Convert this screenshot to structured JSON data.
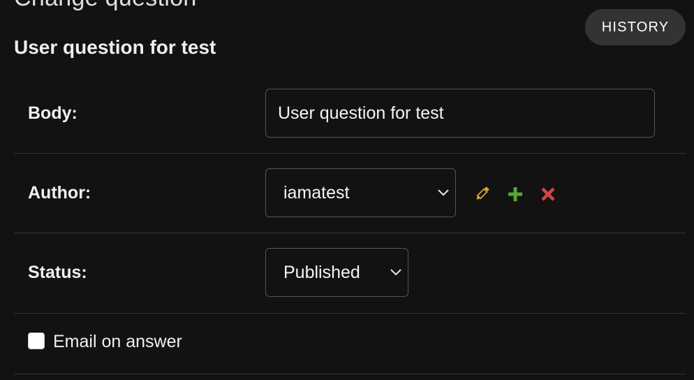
{
  "header": {
    "page_title": "Change question",
    "history_label": "HISTORY"
  },
  "fieldset": {
    "title": "User question for test"
  },
  "fields": {
    "body": {
      "label": "Body:",
      "value": "User question for test"
    },
    "author": {
      "label": "Author:",
      "selected": "iamatest",
      "actions": [
        "pencil-icon",
        "plus-icon",
        "x-icon"
      ]
    },
    "status": {
      "label": "Status:",
      "selected": "Published"
    },
    "email_on_answer": {
      "label": "Email on answer",
      "checked": false
    }
  },
  "colors": {
    "background": "#121212",
    "edit_icon": "#d4a531",
    "add_icon": "#57a733",
    "delete_icon": "#d04646",
    "history_button_bg": "#333333",
    "border": "#555555"
  }
}
